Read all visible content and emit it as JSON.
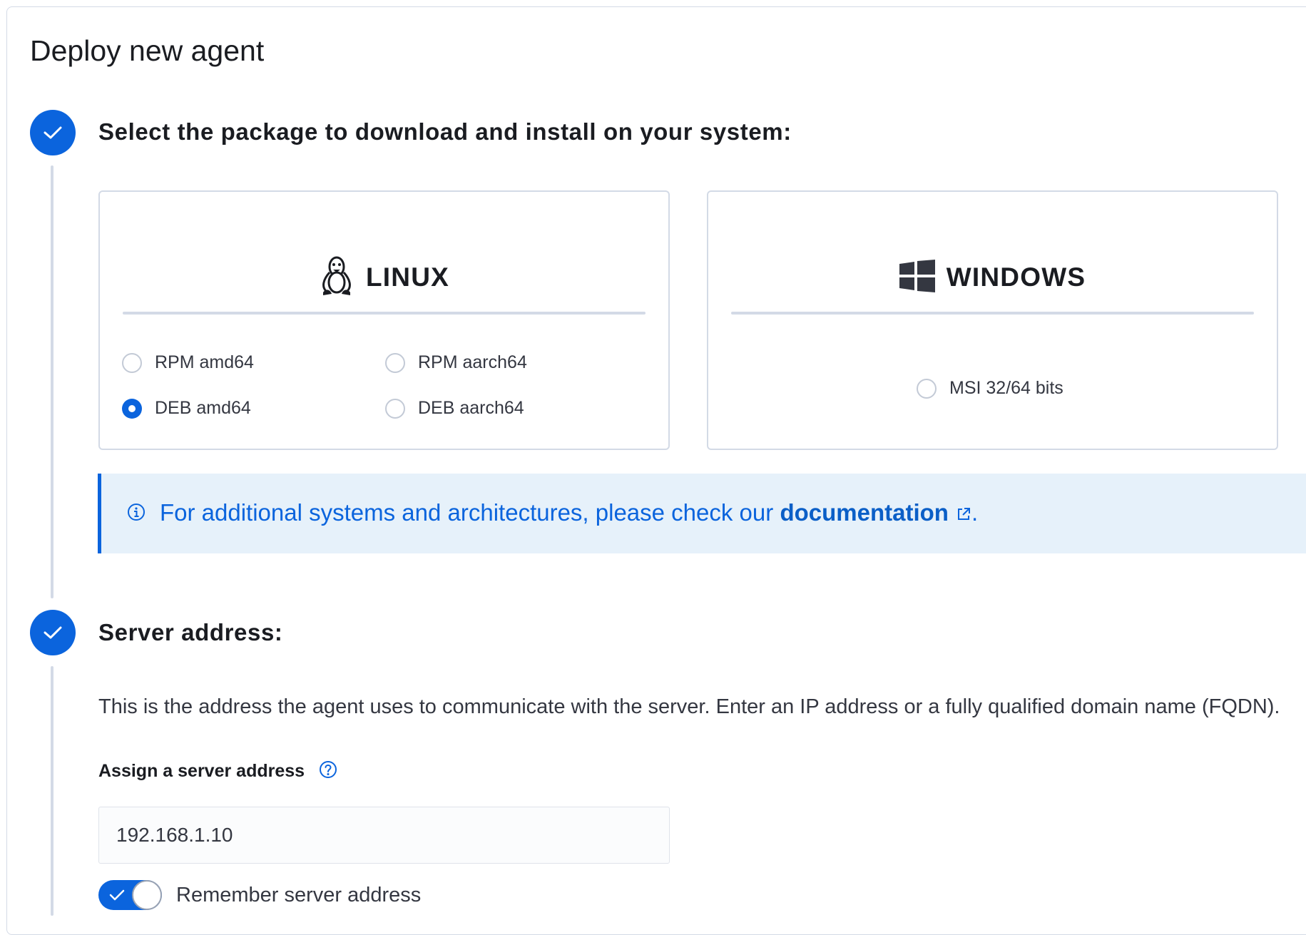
{
  "page": {
    "title": "Deploy new agent"
  },
  "step1": {
    "title": "Select the package to download and install on your system:",
    "linux": {
      "title": "LINUX",
      "icon": "linux-penguin-icon",
      "options": [
        {
          "label": "RPM amd64",
          "selected": false
        },
        {
          "label": "RPM aarch64",
          "selected": false
        },
        {
          "label": "DEB amd64",
          "selected": true
        },
        {
          "label": "DEB aarch64",
          "selected": false
        }
      ]
    },
    "windows": {
      "title": "WINDOWS",
      "icon": "windows-logo-icon",
      "options": [
        {
          "label": "MSI 32/64 bits",
          "selected": false
        }
      ]
    },
    "callout": {
      "text_before": "For additional systems and architectures, please check our ",
      "link_text": "documentation",
      "text_after": "."
    }
  },
  "step2": {
    "title": "Server address:",
    "description": "This is the address the agent uses to communicate with the server. Enter an IP address or a fully qualified domain name (FQDN).",
    "field_label": "Assign a server address",
    "input_value": "192.168.1.10",
    "remember_label": "Remember server address",
    "remember_on": true
  },
  "colors": {
    "accent": "#0b64dd",
    "callout_bg": "#e6f1fa",
    "border": "#d3dae6"
  }
}
